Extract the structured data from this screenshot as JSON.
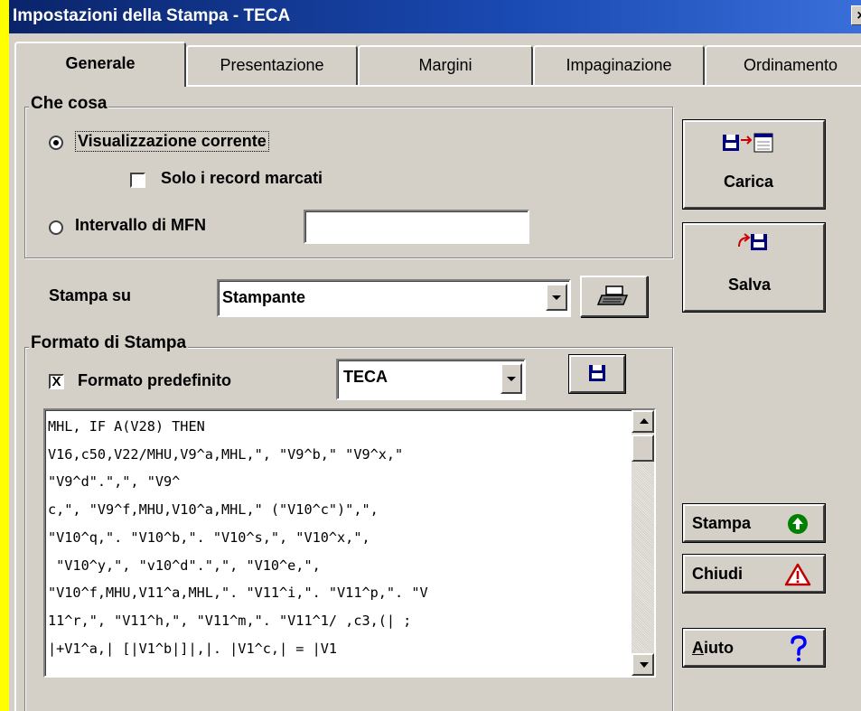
{
  "window": {
    "title": "Impostazioni della Stampa - TECA",
    "close_glyph": "×"
  },
  "tabs": [
    {
      "label": "Generale",
      "active": true
    },
    {
      "label": "Presentazione",
      "active": false
    },
    {
      "label": "Margini",
      "active": false
    },
    {
      "label": "Impaginazione",
      "active": false
    },
    {
      "label": "Ordinamento",
      "active": false
    }
  ],
  "che_cosa": {
    "legend": "Che cosa",
    "radio_current": {
      "label": "Visualizzazione corrente",
      "checked": true
    },
    "checkbox_marked": {
      "label": "Solo i record marcati",
      "checked": false
    },
    "radio_range": {
      "label": "Intervallo di MFN",
      "checked": false
    },
    "mfn_value": ""
  },
  "stampa_su": {
    "label": "Stampa su",
    "value": "Stampante"
  },
  "formato": {
    "legend": "Formato di Stampa",
    "checkbox_label": "Formato predefinito",
    "checkbox_checked": true,
    "checkbox_mark": "X",
    "select_value": "TECA",
    "code": "MHL, IF A(V28) THEN\nV16,c50,V22/MHU,V9^a,MHL,\", \"V9^b,\" \"V9^x,\"\n\"V9^d\".\",\", \"V9^\nc,\", \"V9^f,MHU,V10^a,MHL,\" (\"V10^c\")\",\",\n\"V10^q,\". \"V10^b,\". \"V10^s,\", \"V10^x,\",\n \"V10^y,\", \"v10^d\".\",\", \"V10^e,\",\n\"V10^f,MHU,V11^a,MHL,\". \"V11^i,\". \"V11^p,\". \"V\n11^r,\", \"V11^h,\", \"V11^m,\". \"V11^1/ ,c3,(| ;\n|+V1^a,| [|V1^b|]|,|. |V1^c,| = |V1"
  },
  "buttons": {
    "carica": "Carica",
    "salva": "Salva",
    "stampa": "Stampa",
    "chiudi": "Chiudi",
    "aiuto_first": "A",
    "aiuto_rest": "iuto"
  },
  "colors": {
    "titlebar": "#0a246a",
    "background": "#ffff00",
    "face": "#d4d0c8",
    "disk_blue": "#00007b",
    "stampa_green": "#008000",
    "warning_red": "#c00000",
    "help_blue": "#0000ff"
  },
  "icons": {
    "carica": "floppy-to-list-icon",
    "salva": "arrow-to-floppy-icon",
    "printer": "printer-icon",
    "save_format": "floppy-icon",
    "stampa": "green-up-arrow-icon",
    "chiudi": "warning-triangle-icon",
    "aiuto": "question-mark-icon"
  }
}
